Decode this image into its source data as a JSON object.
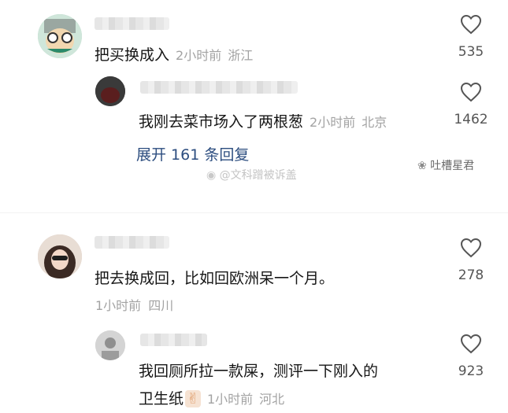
{
  "comments": [
    {
      "text": "把买换成入",
      "time": "2小时前",
      "location": "浙江",
      "likes": "535",
      "reply": {
        "text": "我刚去菜市场入了两根葱",
        "time": "2小时前",
        "location": "北京",
        "likes": "1462"
      },
      "expand_label": "展开 161 条回复"
    },
    {
      "text": "把去换成回，比如回欧洲呆一个月。",
      "time": "1小时前",
      "location": "四川",
      "likes": "278",
      "reply": {
        "text_line1": "我回厕所拉一款屎，测评一下刚入的",
        "text_line2": "卫生纸",
        "emoji": "✌",
        "time": "1小时前",
        "location": "河北",
        "likes": "923"
      }
    }
  ],
  "watermarks": {
    "weibo": "@文科蹭被诉盖",
    "wechat": "吐槽星君"
  }
}
